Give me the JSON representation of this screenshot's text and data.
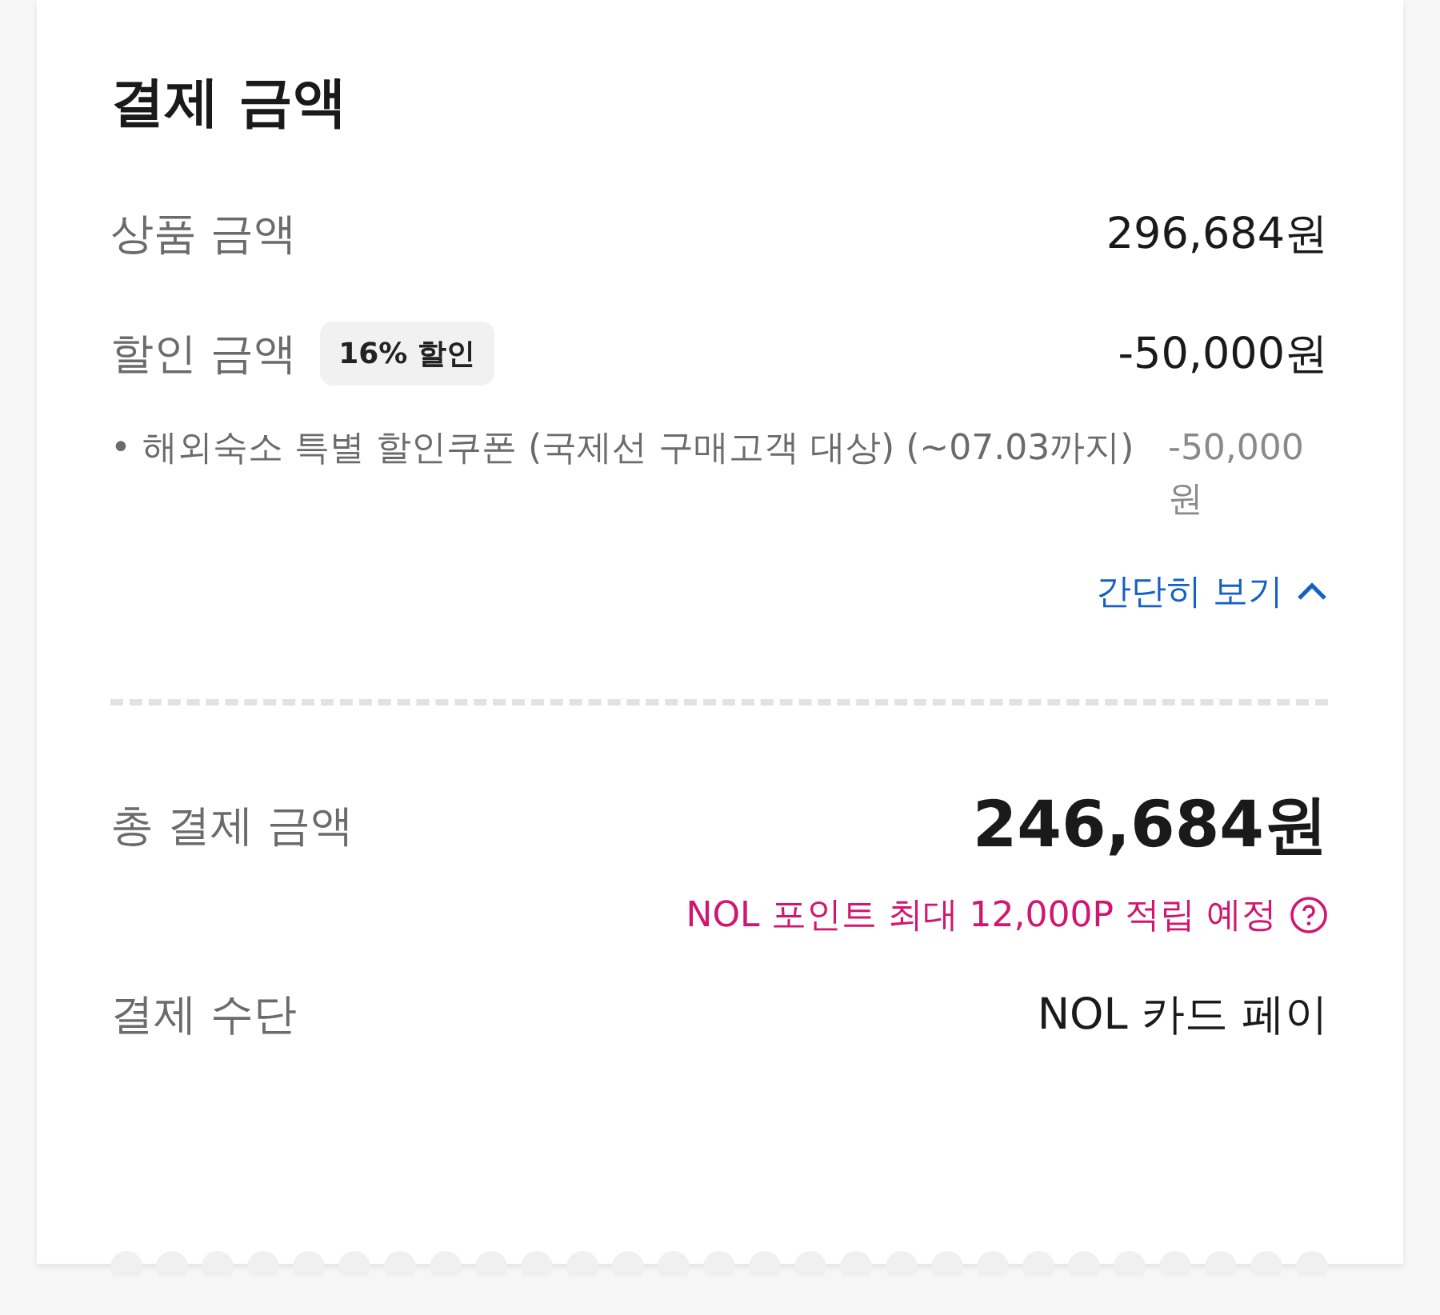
{
  "title": "결제 금액",
  "product": {
    "label": "상품 금액",
    "amount": "296,684원"
  },
  "discount": {
    "label": "할인 금액",
    "badge": "16% 할인",
    "amount": "-50,000원"
  },
  "discount_items": [
    {
      "label": "• 해외숙소 특별 할인쿠폰 (국제선 구매고객 대상) (~07.03까지)",
      "amount": "-50,000원"
    }
  ],
  "collapse_link": {
    "label": "간단히 보기",
    "expanded": true
  },
  "total": {
    "label": "총 결제 금액",
    "amount": "246,684원"
  },
  "points_note": "NOL 포인트 최대 12,000P 적립 예정",
  "payment_method": {
    "label": "결제 수단",
    "value": "NOL 카드 페이"
  }
}
